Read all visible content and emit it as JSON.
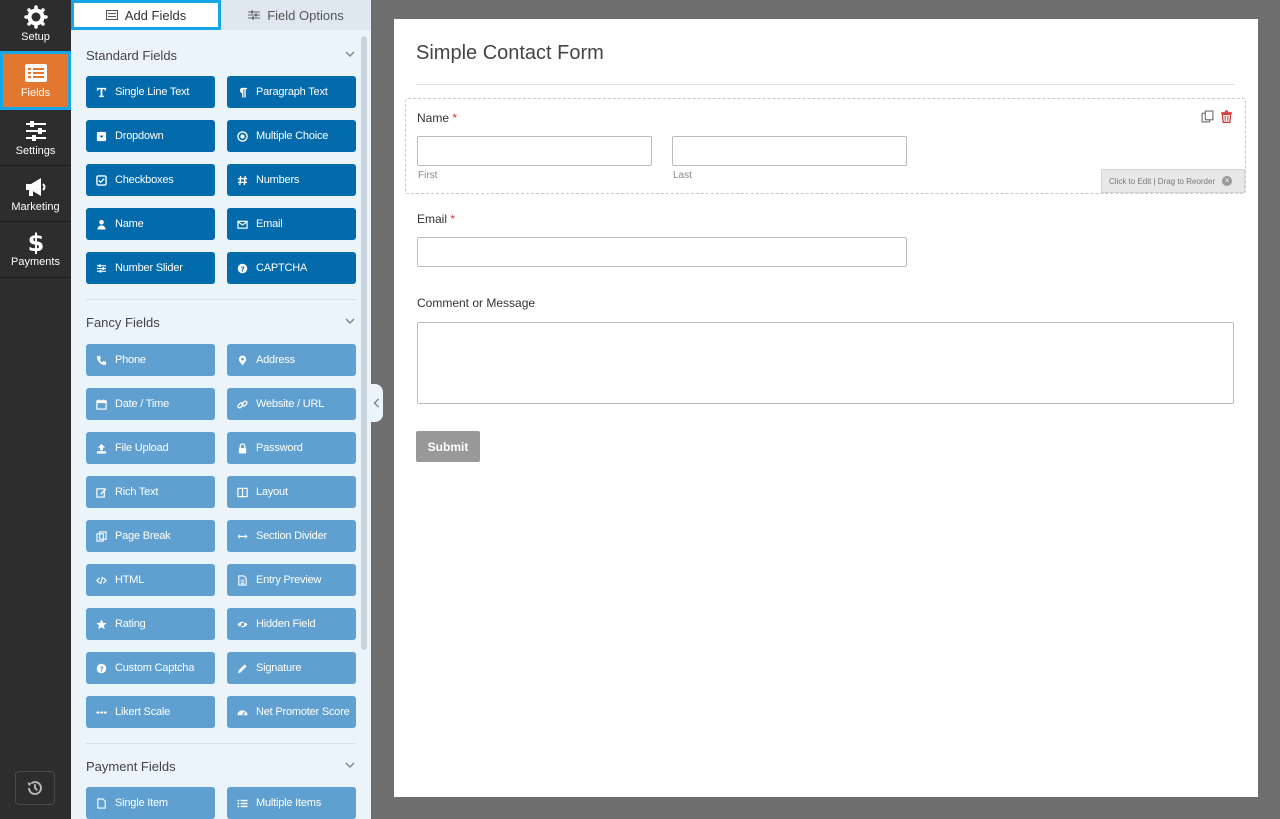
{
  "nav": {
    "items": [
      {
        "label": "Setup",
        "icon": "gear-icon"
      },
      {
        "label": "Fields",
        "icon": "list-icon",
        "active": true
      },
      {
        "label": "Settings",
        "icon": "sliders-icon"
      },
      {
        "label": "Marketing",
        "icon": "megaphone-icon"
      },
      {
        "label": "Payments",
        "icon": "dollar-icon"
      }
    ],
    "bottom_icon": "history-icon"
  },
  "panel": {
    "tabs": {
      "add_fields": "Add Fields",
      "field_options": "Field Options"
    },
    "sections": {
      "standard": "Standard Fields",
      "fancy": "Fancy Fields",
      "payment": "Payment Fields"
    },
    "standard_fields": [
      "Single Line Text",
      "Paragraph Text",
      "Dropdown",
      "Multiple Choice",
      "Checkboxes",
      "Numbers",
      "Name",
      "Email",
      "Number Slider",
      "CAPTCHA"
    ],
    "fancy_fields": [
      "Phone",
      "Address",
      "Date / Time",
      "Website / URL",
      "File Upload",
      "Password",
      "Rich Text",
      "Layout",
      "Page Break",
      "Section Divider",
      "HTML",
      "Entry Preview",
      "Rating",
      "Hidden Field",
      "Custom Captcha",
      "Signature",
      "Likert Scale",
      "Net Promoter Score"
    ],
    "payment_fields": [
      "Single Item",
      "Multiple Items"
    ]
  },
  "form": {
    "title": "Simple Contact Form",
    "name_label": "Name",
    "required_mark": "*",
    "first_label": "First",
    "last_label": "Last",
    "email_label": "Email",
    "comment_label": "Comment or Message",
    "submit_label": "Submit",
    "reorder_hint": "Click to Edit | Drag to Reorder",
    "reorder_close": "×"
  },
  "colors": {
    "nav_bg": "#2d2d2d",
    "nav_active": "#e27730",
    "highlight": "#16a6e8",
    "standard_button": "#036aab",
    "fancy_button": "#5fa0d0"
  }
}
